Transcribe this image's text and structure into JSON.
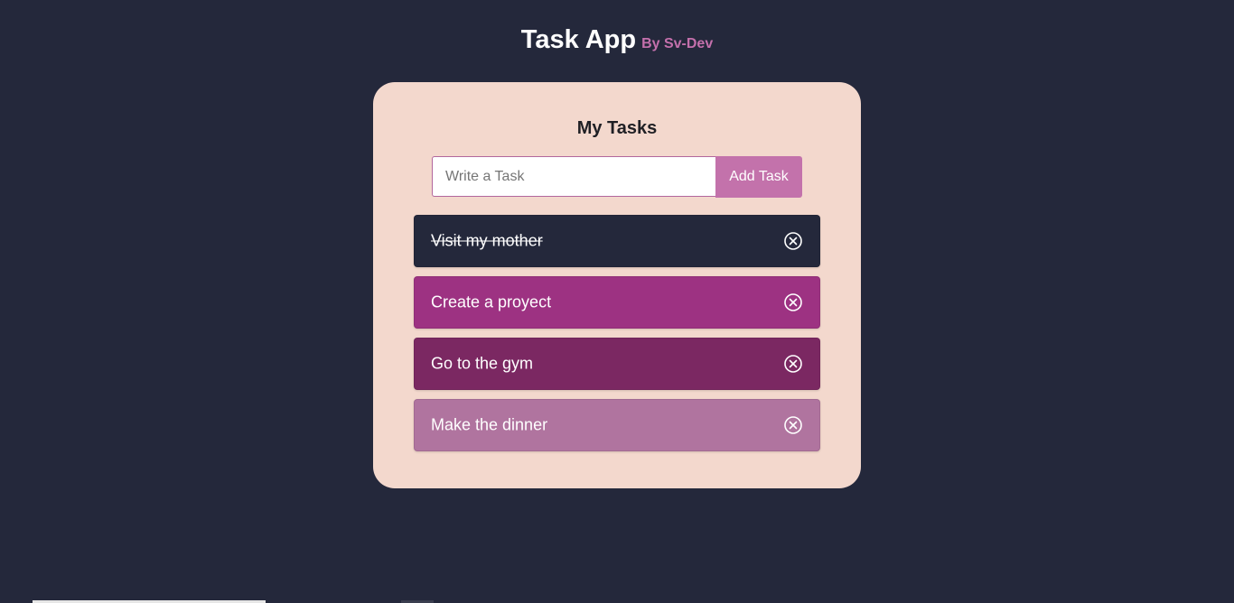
{
  "header": {
    "title": "Task App",
    "subtitle": "By Sv-Dev"
  },
  "card": {
    "title": "My Tasks",
    "input": {
      "placeholder": "Write a Task",
      "value": ""
    },
    "add_button_label": "Add Task"
  },
  "tasks": [
    {
      "label": "Visit my mother",
      "completed": true,
      "color": "#24283b"
    },
    {
      "label": "Create a proyect",
      "completed": false,
      "color": "#9d3282"
    },
    {
      "label": "Go to the gym",
      "completed": false,
      "color": "#7b2862"
    },
    {
      "label": "Make the dinner",
      "completed": false,
      "color": "#b0749f"
    }
  ],
  "icons": {
    "delete": "close-circle-icon"
  },
  "colors": {
    "background": "#24283b",
    "card": "#f3d8cd",
    "accent": "#c372ab"
  }
}
